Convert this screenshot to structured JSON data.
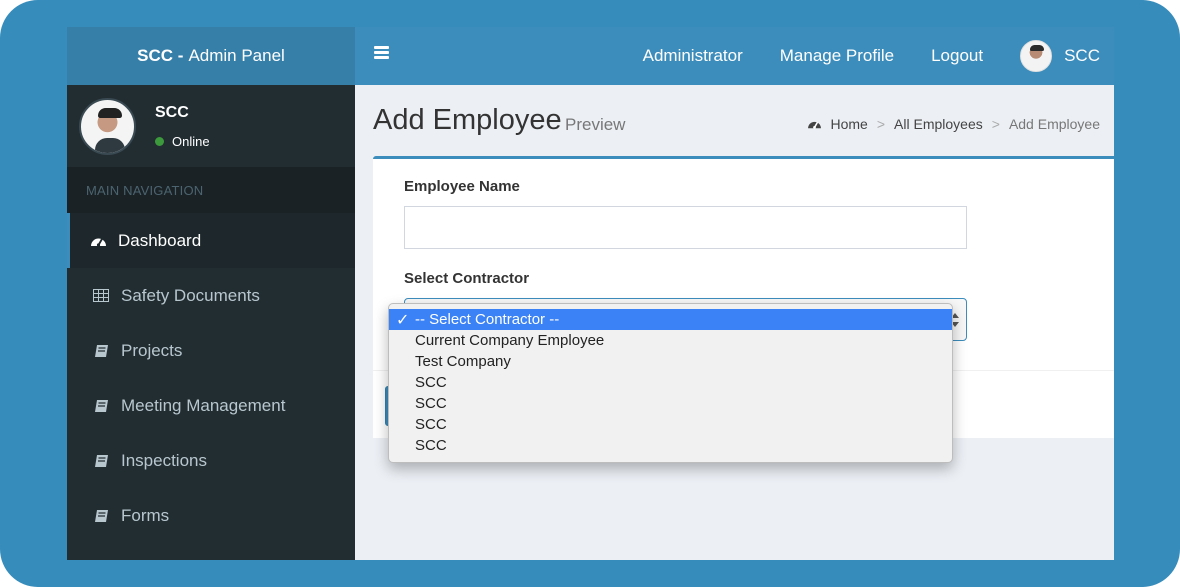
{
  "brand": {
    "bold": "SCC -",
    "rest": "Admin Panel"
  },
  "header": {
    "links": [
      "Administrator",
      "Manage Profile",
      "Logout"
    ],
    "user_name": "SCC"
  },
  "sidebar": {
    "user": {
      "name": "SCC",
      "status": "Online"
    },
    "nav_header": "MAIN NAVIGATION",
    "items": [
      {
        "label": "Dashboard",
        "icon": "dashboard-icon",
        "active": true
      },
      {
        "label": "Safety Documents",
        "icon": "table-icon",
        "active": false
      },
      {
        "label": "Projects",
        "icon": "book-icon",
        "active": false
      },
      {
        "label": "Meeting Management",
        "icon": "book-icon",
        "active": false
      },
      {
        "label": "Inspections",
        "icon": "book-icon",
        "active": false
      },
      {
        "label": "Forms",
        "icon": "book-icon",
        "active": false
      }
    ]
  },
  "page": {
    "title": "Add Employee",
    "subtitle": "Preview",
    "breadcrumb": [
      "Home",
      "All Employees",
      "Add Employee"
    ]
  },
  "form": {
    "employee_name_label": "Employee Name",
    "employee_name_value": "",
    "contractor_label": "Select Contractor"
  },
  "dropdown": {
    "options": [
      "-- Select Contractor --",
      "Current Company Employee",
      "Test Company",
      "SCC",
      "SCC",
      "SCC",
      "SCC"
    ],
    "selected_index": 0
  },
  "colors": {
    "frame": "#368cbb",
    "header": "#3c8dbc",
    "brand": "#367fa9",
    "sidebar": "#222d32",
    "option_highlight": "#3b82f6"
  }
}
